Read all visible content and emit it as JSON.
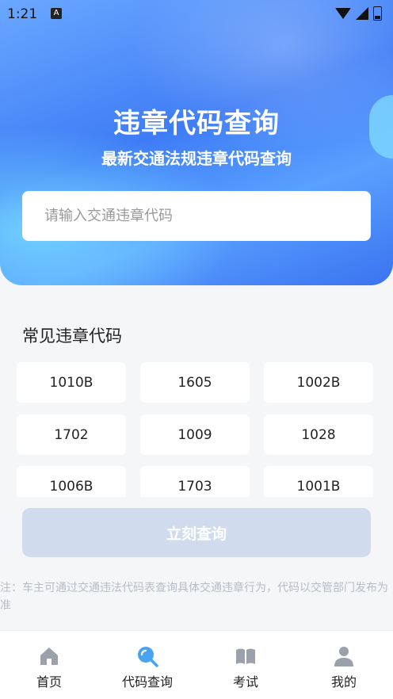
{
  "status": {
    "time": "1:21",
    "notif": "A"
  },
  "header": {
    "title": "违章代码查询",
    "subtitle": "最新交通法规违章代码查询"
  },
  "search": {
    "placeholder": "请输入交通违章代码",
    "value": ""
  },
  "common": {
    "title": "常见违章代码",
    "codes": [
      "1010B",
      "1605",
      "1002B",
      "1702",
      "1009",
      "1028",
      "1006B",
      "1703",
      "1001B"
    ]
  },
  "submit": {
    "label": "立刻查询"
  },
  "note": "注：车主可通过交通违法代码表查询具体交通违章行为，代码以交管部门发布为准",
  "tabs": [
    {
      "label": "首页",
      "icon": "home-icon"
    },
    {
      "label": "代码查询",
      "icon": "search-icon"
    },
    {
      "label": "考试",
      "icon": "book-icon"
    },
    {
      "label": "我的",
      "icon": "user-icon"
    }
  ],
  "colors": {
    "primary": "#3e7cf6",
    "active_icon": "#4aa3f0",
    "inactive_icon": "#9aa1ab",
    "button_disabled": "#d0dcee"
  }
}
